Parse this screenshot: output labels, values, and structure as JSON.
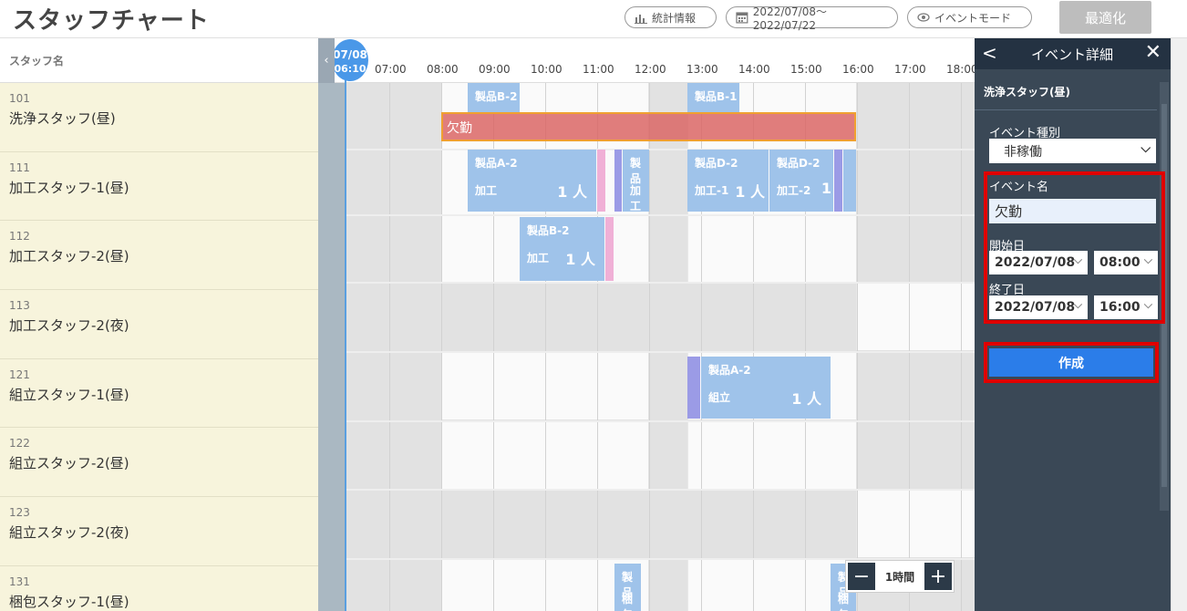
{
  "header": {
    "title": "スタッフチャート",
    "stats_label": "統計情報",
    "date_range": "2022/07/08〜2022/07/22",
    "event_mode_label": "イベントモード",
    "optimize_label": "最適化"
  },
  "staff": {
    "header": "スタッフ名",
    "rows": [
      {
        "id": "101",
        "name": "洗浄スタッフ(昼)"
      },
      {
        "id": "111",
        "name": "加工スタッフ-1(昼)"
      },
      {
        "id": "112",
        "name": "加工スタッフ-2(昼)"
      },
      {
        "id": "113",
        "name": "加工スタッフ-2(夜)"
      },
      {
        "id": "121",
        "name": "組立スタッフ-1(昼)"
      },
      {
        "id": "122",
        "name": "組立スタッフ-2(昼)"
      },
      {
        "id": "123",
        "name": "組立スタッフ-2(夜)"
      },
      {
        "id": "131",
        "name": "梱包スタッフ-1(昼)"
      }
    ]
  },
  "timeline": {
    "now_date": "07/08",
    "now_time": "06:10",
    "hours": [
      "07:00",
      "08:00",
      "09:00",
      "10:00",
      "11:00",
      "12:00",
      "13:00",
      "14:00",
      "15:00",
      "16:00",
      "17:00",
      "18:00"
    ]
  },
  "tasks": {
    "absent_label": "欠勤",
    "t1": {
      "product": "製品B-2"
    },
    "t2": {
      "product": "製品B-1"
    },
    "t3": {
      "product": "製品A-2",
      "step": "加工",
      "count": "1 人"
    },
    "t4": {
      "product": "製品",
      "step": "加工"
    },
    "t5": {
      "product": "製品D-2",
      "step": "加工-1",
      "count": "1 人"
    },
    "t6": {
      "product": "製品D-2",
      "step": "加工-2",
      "count": "1"
    },
    "t7": {
      "product": "製品B-2",
      "step": "加工",
      "count": "1 人"
    },
    "t8": {
      "product": "製品A-2",
      "step": "組立",
      "count": "1 人"
    },
    "t9": {
      "product": "製品",
      "step": "梱包"
    },
    "t10": {
      "product": "製品",
      "step": "梱包"
    }
  },
  "zoom": {
    "label": "1時間",
    "minus": "−",
    "plus": "+"
  },
  "panel": {
    "back": "<",
    "title": "イベント詳細",
    "close": "✕",
    "staff_name": "洗浄スタッフ(昼)",
    "event_type_label": "イベント種別",
    "event_type_value": "非稼働",
    "event_name_label": "イベント名",
    "event_name_value": "欠勤",
    "start_label": "開始日",
    "start_date": "2022/07/08",
    "start_time": "08:00",
    "end_label": "終了日",
    "end_date": "2022/07/08",
    "end_time": "16:00",
    "create_label": "作成"
  },
  "colors": {
    "task": "#9fc3ea",
    "absent": "#da6260",
    "accent": "#2b7de9",
    "highlight": "#e00000",
    "panel": "#3a4856"
  }
}
